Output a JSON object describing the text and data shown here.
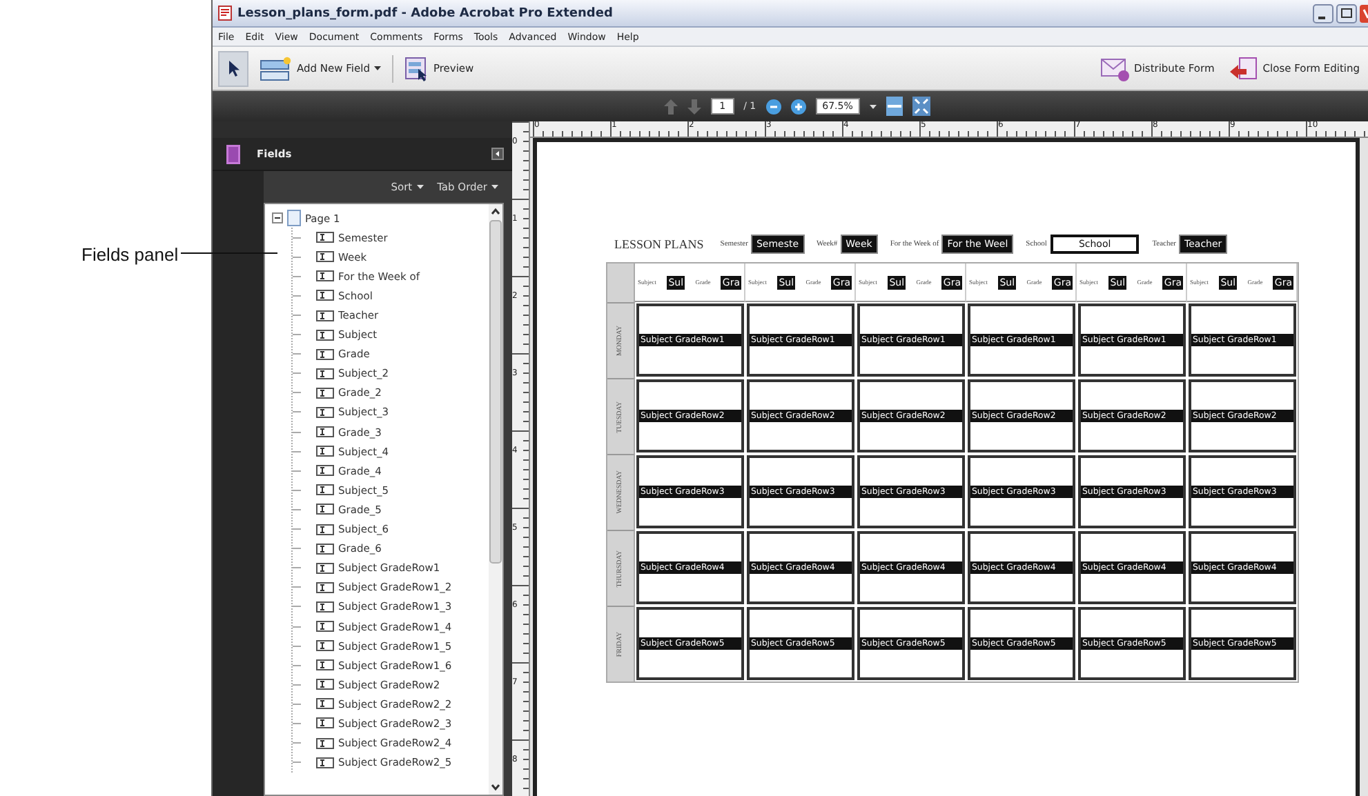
{
  "annotation": {
    "label": "Fields panel"
  },
  "window": {
    "title": "Lesson_plans_form.pdf - Adobe Acrobat Pro Extended"
  },
  "menu": [
    "File",
    "Edit",
    "View",
    "Document",
    "Comments",
    "Forms",
    "Tools",
    "Advanced",
    "Window",
    "Help"
  ],
  "toolbar": {
    "add_field": "Add New Field",
    "preview": "Preview",
    "distribute": "Distribute Form",
    "close_editing": "Close Form Editing"
  },
  "navigation": {
    "page": "1",
    "page_total": "/ 1",
    "zoom": "67.5%"
  },
  "fields_panel": {
    "title": "Fields",
    "sort": "Sort",
    "tab_order": "Tab Order",
    "tree": [
      {
        "label": "Page 1",
        "expanded": true,
        "children": [
          {
            "label": "Semester"
          },
          {
            "label": "Week"
          },
          {
            "label": "For the Week of"
          },
          {
            "label": "School"
          },
          {
            "label": "Teacher"
          },
          {
            "label": "Subject"
          },
          {
            "label": "Grade"
          },
          {
            "label": "Subject_2"
          },
          {
            "label": "Grade_2"
          },
          {
            "label": "Subject_3"
          },
          {
            "label": "Grade_3"
          },
          {
            "label": "Subject_4"
          },
          {
            "label": "Grade_4"
          },
          {
            "label": "Subject_5"
          },
          {
            "label": "Grade_5"
          },
          {
            "label": "Subject_6"
          },
          {
            "label": "Grade_6"
          },
          {
            "label": "Subject GradeRow1"
          },
          {
            "label": "Subject GradeRow1_2"
          },
          {
            "label": "Subject GradeRow1_3"
          },
          {
            "label": "Subject GradeRow1_4"
          },
          {
            "label": "Subject GradeRow1_5"
          },
          {
            "label": "Subject GradeRow1_6"
          },
          {
            "label": "Subject GradeRow2"
          },
          {
            "label": "Subject GradeRow2_2"
          },
          {
            "label": "Subject GradeRow2_3"
          },
          {
            "label": "Subject GradeRow2_4"
          },
          {
            "label": "Subject GradeRow2_5"
          }
        ]
      }
    ]
  },
  "ruler": {
    "horizontal": [
      "0",
      "1",
      "2",
      "3",
      "4",
      "5",
      "6",
      "7",
      "8",
      "9",
      "10"
    ],
    "vertical": [
      "0",
      "1",
      "2",
      "3",
      "4",
      "5",
      "6",
      "7",
      "8"
    ]
  },
  "form": {
    "title": "LESSON PLANS",
    "header_fields": [
      {
        "label": "Semester",
        "value": "Semeste",
        "selected": false
      },
      {
        "label": "Week#",
        "value": "Week",
        "selected": false
      },
      {
        "label": "For the Week of",
        "value": "For the Weel",
        "selected": false
      },
      {
        "label": "School",
        "value": "School",
        "selected": true
      },
      {
        "label": "Teacher",
        "value": "Teacher",
        "selected": false
      }
    ],
    "columns": [
      {
        "subject_label": "Subject",
        "subject_value": "Sul",
        "grade_label": "Grade",
        "grade_value": "Gra"
      },
      {
        "subject_label": "Subject",
        "subject_value": "Sul",
        "grade_label": "Grade",
        "grade_value": "Gra"
      },
      {
        "subject_label": "Subject",
        "subject_value": "Sul",
        "grade_label": "Grade",
        "grade_value": "Gra"
      },
      {
        "subject_label": "Subject",
        "subject_value": "Sul",
        "grade_label": "Grade",
        "grade_value": "Gra"
      },
      {
        "subject_label": "Subject",
        "subject_value": "Sul",
        "grade_label": "Grade",
        "grade_value": "Gra"
      },
      {
        "subject_label": "Subject",
        "subject_value": "Sul",
        "grade_label": "Grade",
        "grade_value": "Gra"
      }
    ],
    "rows": [
      {
        "day": "MONDAY",
        "cells": [
          "Subject GradeRow1",
          "Subject GradeRow1",
          "Subject GradeRow1",
          "Subject GradeRow1",
          "Subject GradeRow1",
          "Subject GradeRow1"
        ]
      },
      {
        "day": "TUESDAY",
        "cells": [
          "Subject GradeRow2",
          "Subject GradeRow2",
          "Subject GradeRow2",
          "Subject GradeRow2",
          "Subject GradeRow2",
          "Subject GradeRow2"
        ]
      },
      {
        "day": "WEDNESDAY",
        "cells": [
          "Subject GradeRow3",
          "Subject GradeRow3",
          "Subject GradeRow3",
          "Subject GradeRow3",
          "Subject GradeRow3",
          "Subject GradeRow3"
        ]
      },
      {
        "day": "THURSDAY",
        "cells": [
          "Subject GradeRow4",
          "Subject GradeRow4",
          "Subject GradeRow4",
          "Subject GradeRow4",
          "Subject GradeRow4",
          "Subject GradeRow4"
        ]
      },
      {
        "day": "FRIDAY",
        "cells": [
          "Subject GradeRow5",
          "Subject GradeRow5",
          "Subject GradeRow5",
          "Subject GradeRow5",
          "Subject GradeRow5",
          "Subject GradeRow5"
        ]
      }
    ]
  }
}
